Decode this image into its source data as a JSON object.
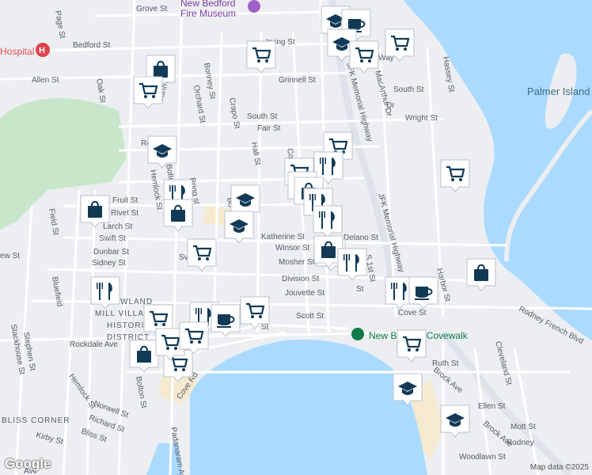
{
  "roads": [
    {
      "label": "Grove St"
    },
    {
      "label": "Page St"
    },
    {
      "label": "Bedford St"
    },
    {
      "label": "Hospital"
    },
    {
      "label": "Allen St"
    },
    {
      "label": "Dartmouth St"
    },
    {
      "label": "Bonney St"
    },
    {
      "label": "Orchard St"
    },
    {
      "label": "Crapo St"
    },
    {
      "label": "Grinnell St"
    },
    {
      "label": "Oak St"
    },
    {
      "label": "South St"
    },
    {
      "label": "Fair St"
    },
    {
      "label": "Hall St"
    },
    {
      "label": "Co"
    },
    {
      "label": "Wright St"
    },
    {
      "label": "South St"
    },
    {
      "label": "Hassey St"
    },
    {
      "label": "MacArthur Dr"
    },
    {
      "label": "JFK Memorial Highway"
    },
    {
      "label": "JFK Memorial Highway"
    },
    {
      "label": "Hemlock St"
    },
    {
      "label": "Bolton St"
    },
    {
      "label": "Brigg st"
    },
    {
      "label": "Fruit St"
    },
    {
      "label": "Rivet St"
    },
    {
      "label": "Larch St"
    },
    {
      "label": "Swift St"
    },
    {
      "label": "Dunbar St"
    },
    {
      "label": "Sidney St"
    },
    {
      "label": "Field St"
    },
    {
      "label": "Katherine St"
    },
    {
      "label": "Winsor St"
    },
    {
      "label": "Mosher St"
    },
    {
      "label": "Division St"
    },
    {
      "label": "Jouvette St"
    },
    {
      "label": "Scott St"
    },
    {
      "label": "Cove St"
    },
    {
      "label": "Harbor St"
    },
    {
      "label": "Rodney French Blvd"
    },
    {
      "label": "Ruth St"
    },
    {
      "label": "Cleveland St"
    },
    {
      "label": "Ellen St"
    },
    {
      "label": "Mott St"
    },
    {
      "label": "Brock Ave"
    },
    {
      "label": "Brock Ave"
    },
    {
      "label": "Rodney"
    },
    {
      "label": "Woodlawn St"
    },
    {
      "label": "Rockdale Ave"
    },
    {
      "label": "Stackhouse St"
    },
    {
      "label": "Stephen St"
    },
    {
      "label": "Hemlock St"
    },
    {
      "label": "Norwell St"
    },
    {
      "label": "Richard St"
    },
    {
      "label": "Bliss St"
    },
    {
      "label": "Kirby St"
    },
    {
      "label": "Padanaram Ave"
    },
    {
      "label": "Cove Rd"
    },
    {
      "label": "Bolton St"
    },
    {
      "label": "Bluefield"
    },
    {
      "label": "Sv"
    },
    {
      "label": "Bo"
    },
    {
      "label": "Ro"
    },
    {
      "label": "S 1st St"
    },
    {
      "label": "Delano St"
    },
    {
      "label": "Irving St"
    },
    {
      "label": "ew St"
    },
    {
      "label": "St"
    },
    {
      "label": "St"
    },
    {
      "label": "Way"
    },
    {
      "label": "Dr"
    },
    {
      "label": "Ave"
    }
  ],
  "areas": {
    "museum": "New Bedford\nFire Museum",
    "museum_line1": "New Bedford",
    "museum_line2": "Fire Museum",
    "historic_line1": "HOWLAND",
    "historic_line2": "MILL VILLAGE",
    "historic_line3": "HISTORIC",
    "historic_line4": "DISTRICT",
    "bliss_corner": "BLISS CORNER",
    "covewalk": "New Bedford Covewalk",
    "palmer_island": "Palmer Island"
  },
  "pins": [
    {
      "icon": "school-icon"
    },
    {
      "icon": "cafe-icon"
    },
    {
      "icon": "school-icon"
    },
    {
      "icon": "shopping-cart-icon"
    },
    {
      "icon": "shopping-cart-icon"
    },
    {
      "icon": "shopping-cart-icon"
    },
    {
      "icon": "shopping-bag-icon"
    },
    {
      "icon": "shopping-cart-icon"
    },
    {
      "icon": "school-icon"
    },
    {
      "icon": "shopping-cart-icon"
    },
    {
      "icon": "restaurant-icon"
    },
    {
      "icon": "shopping-cart-icon"
    },
    {
      "icon": "shopping-bag-icon"
    },
    {
      "icon": "shopping-bag-icon"
    },
    {
      "icon": "restaurant-icon"
    },
    {
      "icon": "restaurant-icon"
    },
    {
      "icon": "shopping-cart-icon"
    },
    {
      "icon": "restaurant-icon"
    },
    {
      "icon": "school-icon"
    },
    {
      "icon": "school-icon"
    },
    {
      "icon": "shopping-bag-icon"
    },
    {
      "icon": "shopping-bag-icon"
    },
    {
      "icon": "restaurant-icon"
    },
    {
      "icon": "shopping-bag-icon"
    },
    {
      "icon": "shopping-cart-icon"
    },
    {
      "icon": "restaurant-icon"
    },
    {
      "icon": "restaurant-icon"
    },
    {
      "icon": "shopping-bag-icon"
    },
    {
      "icon": "shopping-cart-icon"
    },
    {
      "icon": "shopping-cart-icon"
    },
    {
      "icon": "restaurant-icon"
    },
    {
      "icon": "cafe-icon"
    },
    {
      "icon": "shopping-cart-icon"
    },
    {
      "icon": "shopping-cart-icon"
    },
    {
      "icon": "restaurant-icon"
    },
    {
      "icon": "shopping-bag-icon"
    },
    {
      "icon": "shopping-cart-icon"
    },
    {
      "icon": "shopping-cart-icon"
    },
    {
      "icon": "cafe-icon"
    },
    {
      "icon": "school-icon"
    },
    {
      "icon": "school-icon"
    }
  ],
  "attribution": "Map data ©2025",
  "logo": "Google",
  "colors": {
    "water": "#aadaff",
    "land": "#eceef1",
    "park": "#c8e6c9",
    "sand": "#f5ead0",
    "roads": "#ffffff",
    "highway": "#dde3ea",
    "pin_icon": "#123a57",
    "poi_label": "#7b3fa0",
    "covewalk_label": "#0f7a4a",
    "hospital": "#e0434c"
  }
}
